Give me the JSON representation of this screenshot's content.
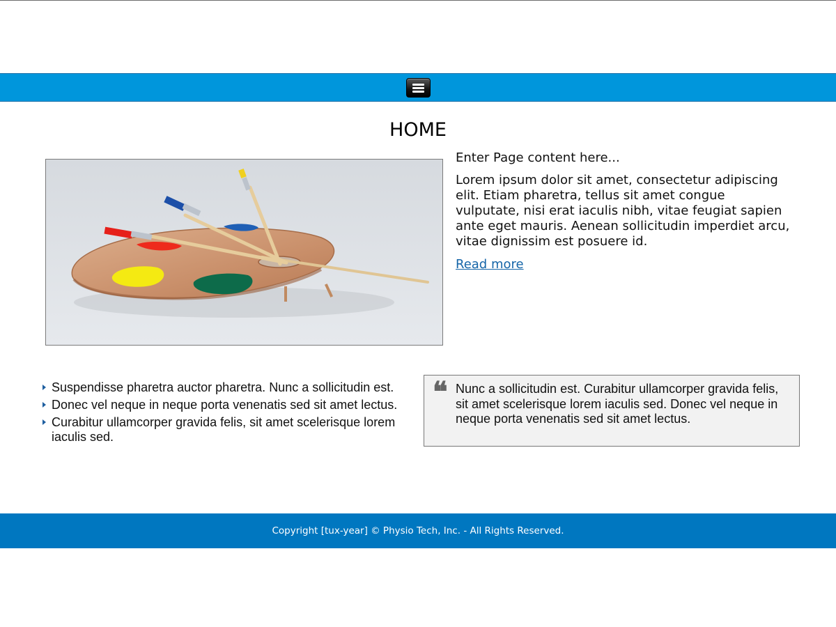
{
  "nav": {
    "menu_icon": "hamburger-menu-icon"
  },
  "page": {
    "title": "HOME"
  },
  "hero": {
    "image_subject": "painter's palette with brushes"
  },
  "intro": {
    "lead": "Enter Page content here...",
    "body": "Lorem ipsum dolor sit amet, consectetur adipiscing elit. Etiam pharetra, tellus sit amet congue vulputate, nisi erat iaculis nibh, vitae feugiat sapien ante eget mauris. Aenean sollicitudin imperdiet arcu, vitae dignissim est posuere id.",
    "read_more": "Read more"
  },
  "list": {
    "items": [
      {
        "text": "Suspendisse pharetra auctor pharetra. Nunc a sollicitudin est."
      },
      {
        "text": "Donec vel neque in neque porta venenatis sed sit amet lectus."
      },
      {
        "text": "Curabitur ullamcorper gravida felis, sit amet scelerisque lorem iaculis sed."
      }
    ]
  },
  "quote": {
    "mark": "❝",
    "text": "Nunc a sollicitudin est. Curabitur ullamcorper gravida felis, sit amet scelerisque lorem iaculis sed. Donec vel neque in neque porta venenatis sed sit amet lectus."
  },
  "footer": {
    "copyright": "Copyright [tux-year] © Physio Tech, Inc. - All Rights Reserved."
  },
  "colors": {
    "nav_bar": "#0096dc",
    "footer": "#0077c0",
    "link": "#1565a8",
    "quote_bg": "#f2f2f2"
  }
}
